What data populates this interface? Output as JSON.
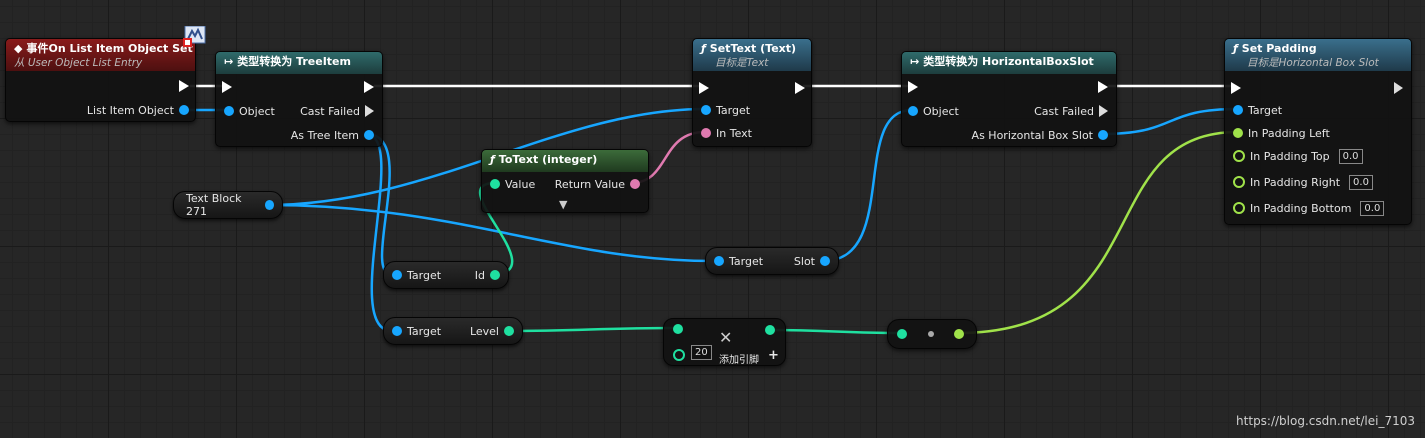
{
  "event_node": {
    "title": "事件On List Item Object Set",
    "subtitle": "从 User Object List Entry",
    "pin_out": "List Item Object"
  },
  "cast_tree": {
    "title": "类型转换为 TreeItem",
    "pin_in": "Object",
    "fail": "Cast Failed",
    "pin_out": "As Tree Item"
  },
  "set_text": {
    "title": "SetText (Text)",
    "subtitle": "目标是Text",
    "pin_target": "Target",
    "pin_text": "In Text"
  },
  "to_text": {
    "title": "ToText (integer)",
    "pin_in": "Value",
    "pin_out": "Return Value"
  },
  "cast_hbox": {
    "title": "类型转换为 HorizontalBoxSlot",
    "pin_in": "Object",
    "fail": "Cast Failed",
    "pin_out": "As Horizontal Box Slot"
  },
  "set_padding": {
    "title": "Set Padding",
    "subtitle": "目标是Horizontal Box Slot",
    "pin_target": "Target",
    "pin_left": "In Padding Left",
    "pin_top": "In Padding Top",
    "top_value": "0.0",
    "pin_right": "In Padding Right",
    "right_value": "0.0",
    "pin_bottom": "In Padding Bottom",
    "bottom_value": "0.0"
  },
  "text_block_var": {
    "label": "Text Block 271"
  },
  "get_id": {
    "target": "Target",
    "out": "Id"
  },
  "get_level": {
    "target": "Target",
    "out": "Level"
  },
  "get_slot": {
    "target": "Target",
    "out": "Slot"
  },
  "multiply_node": {
    "value": "20",
    "add_pin": "添加引脚"
  },
  "watermark": "https://blog.csdn.net/lei_7103",
  "colors": {
    "object": "#17a6ff",
    "text": "#e07ab0",
    "integer": "#1fe0a0",
    "float": "#a0e24a",
    "exec": "#ffffff"
  }
}
